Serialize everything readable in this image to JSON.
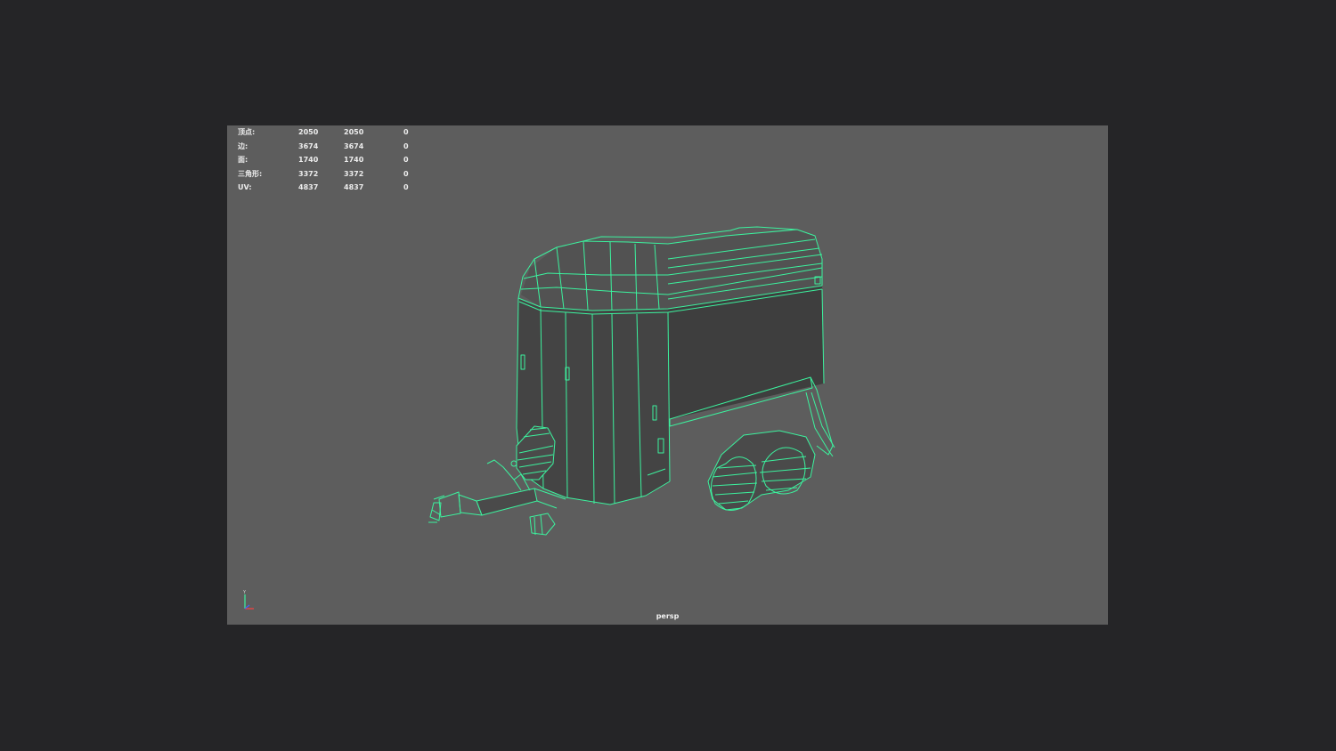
{
  "viewport": {
    "camera": "persp",
    "background_color": "#5d5d5d",
    "wireframe_color": "#3cf29e"
  },
  "hud": {
    "rows": [
      {
        "label": "顶点:",
        "v1": "2050",
        "v2": "2050",
        "v3": "0"
      },
      {
        "label": "边:",
        "v1": "3674",
        "v2": "3674",
        "v3": "0"
      },
      {
        "label": "面:",
        "v1": "1740",
        "v2": "1740",
        "v3": "0"
      },
      {
        "label": "三角形:",
        "v1": "3372",
        "v2": "3372",
        "v3": "0"
      },
      {
        "label": "UV:",
        "v1": "4837",
        "v2": "4837",
        "v3": "0"
      }
    ]
  },
  "axis": {
    "y_label": "Y",
    "x_label": "X",
    "z_label": "Z"
  }
}
